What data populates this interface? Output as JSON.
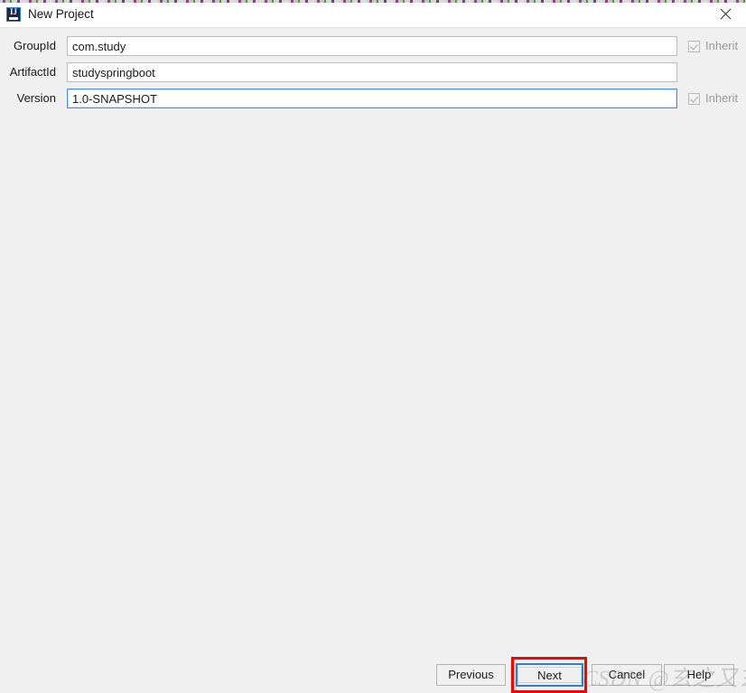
{
  "window": {
    "title": "New Project",
    "icon": "intellij-idea-icon",
    "icon_letters": "IJ",
    "close_label": "×"
  },
  "form": {
    "fields": [
      {
        "label": "GroupId",
        "value": "com.study",
        "placeholder": "",
        "focused": false,
        "inherit": {
          "label": "Inherit",
          "checked": true,
          "enabled": false
        }
      },
      {
        "label": "ArtifactId",
        "value": "studyspringboot",
        "placeholder": "",
        "focused": false,
        "inherit": null
      },
      {
        "label": "Version",
        "value": "1.0-SNAPSHOT",
        "placeholder": "",
        "focused": true,
        "inherit": {
          "label": "Inherit",
          "checked": true,
          "enabled": false
        }
      }
    ]
  },
  "footer": {
    "buttons": [
      {
        "name": "previous",
        "label": "Previous",
        "focused": false
      },
      {
        "name": "next",
        "label": "Next",
        "focused": true
      },
      {
        "name": "cancel",
        "label": "Cancel",
        "focused": false
      },
      {
        "name": "help",
        "label": "Help",
        "focused": false
      }
    ]
  },
  "annotation": {
    "target": "next-button",
    "color": "#ff0000"
  },
  "watermark": {
    "text": "CSDN @玄之又玄"
  },
  "colors": {
    "dialog_background": "#f0f0f0",
    "title_background": "#ffffff",
    "field_border": "#bcbcbc",
    "focus_blue": "#2f7fd0",
    "annotation_red": "#ff0000",
    "disabled_text": "#9a9a9a"
  }
}
